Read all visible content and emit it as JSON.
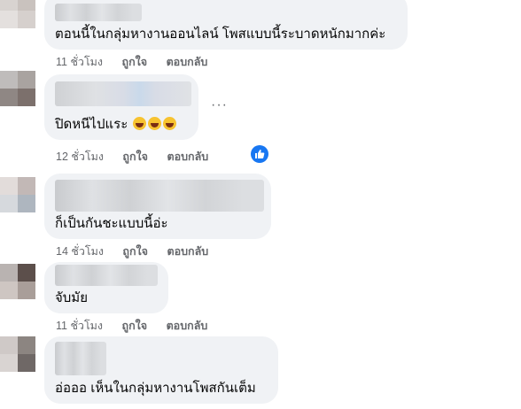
{
  "comments": [
    {
      "text": "ตอนนี้ในกลุ่มหางานออนไลน์ โพสแบบนี้ระบาดหนักมากค่ะ",
      "actions": {
        "time": "11 ชั่วโมง",
        "like": "ถูกใจ",
        "reply": "ตอบกลับ"
      }
    },
    {
      "text": "ปิดหนีไปแระ",
      "emojis": [
        "laughing-emoji",
        "laughing-emoji",
        "laughing-emoji"
      ],
      "actions": {
        "time": "12 ชั่วโมง",
        "like": "ถูกใจ",
        "reply": "ตอบกลับ"
      },
      "more": "···"
    },
    {
      "text": "ก็เป็นกันชะแบบนี้อ่ะ",
      "actions": {
        "time": "14 ชั่วโมง",
        "like": "ถูกใจ",
        "reply": "ตอบกลับ"
      }
    },
    {
      "text": "จับมัย",
      "actions": {
        "time": "11 ชั่วโมง",
        "like": "ถูกใจ",
        "reply": "ตอบกลับ"
      }
    },
    {
      "text": "อ่อออ เห็นในกลุ่มหางานโพสกันเต็ม",
      "actions": {
        "time": "",
        "like": "",
        "reply": ""
      }
    }
  ],
  "colors": {
    "bubble": "#f0f2f5",
    "text": "#050505",
    "secondary_text": "#65676b",
    "like_blue": "#1877f2"
  }
}
